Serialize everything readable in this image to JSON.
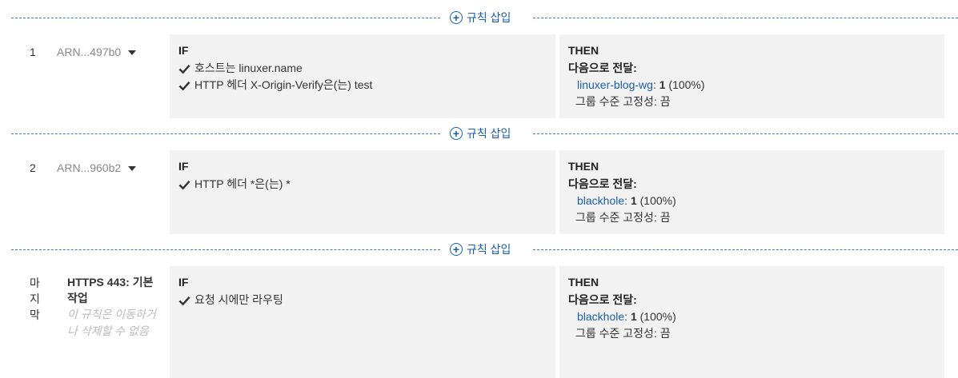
{
  "insert_label": "규칙 삽입",
  "if_label": "IF",
  "then_label": "THEN",
  "forward_label": "다음으로 전달:",
  "stickiness_label": "그룹 수준 고정성:",
  "stickiness_value": "끔",
  "rules": [
    {
      "number": "1",
      "arn": "ARN...497b0",
      "conditions": [
        "호스트는 linuxer.name",
        "HTTP 헤더 X-Origin-Verify은(는) test"
      ],
      "target_group": "linuxer-blog-wg",
      "weight": "1",
      "percent": "(100%)"
    },
    {
      "number": "2",
      "arn": "ARN...960b2",
      "conditions": [
        "HTTP 헤더 *은(는) *"
      ],
      "target_group": "blackhole",
      "weight": "1",
      "percent": "(100%)"
    }
  ],
  "default_rule": {
    "number": "마지막",
    "title": "HTTPS 443: 기본 작업",
    "note": "이 규칙은 이동하거나 삭제할 수 없음",
    "conditions": [
      "요청 시에만 라우팅"
    ],
    "target_group": "blackhole",
    "weight": "1",
    "percent": "(100%)"
  },
  "colors": {
    "link": "#1a5ea8",
    "panel_bg": "#f2f2f2",
    "muted": "#888888"
  }
}
